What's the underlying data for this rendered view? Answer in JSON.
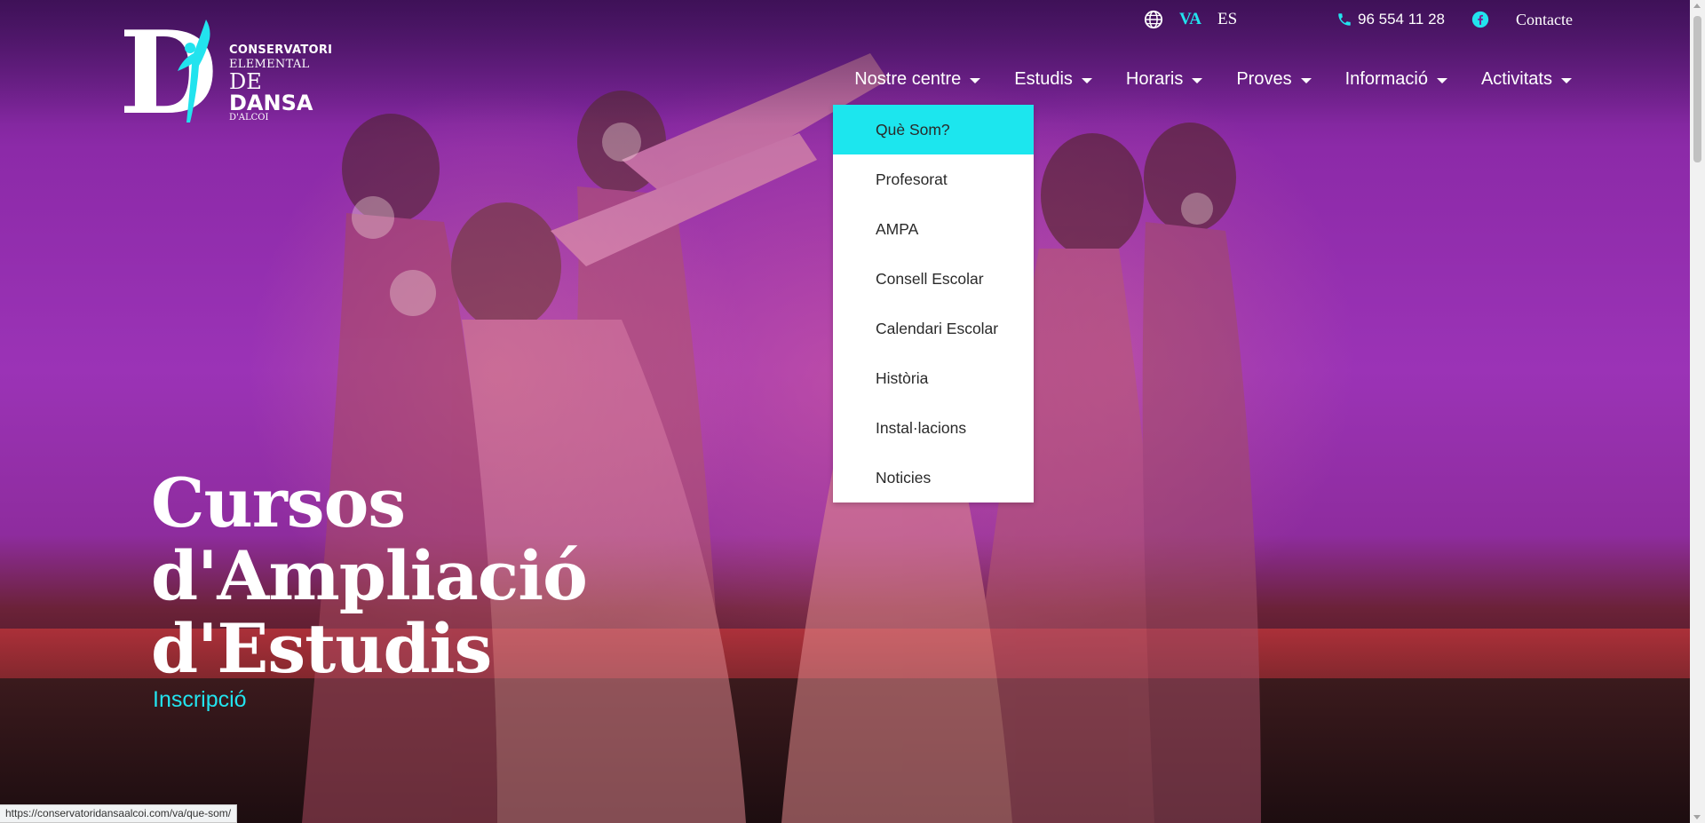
{
  "logo": {
    "letter": "D",
    "line1": "CONSERVATORI",
    "line2": "ELEMENTAL",
    "line3a": "DE",
    "line3b": "DANSA",
    "line4": "D'ALCOI"
  },
  "utility": {
    "languages": [
      {
        "code": "VA",
        "active": true
      },
      {
        "code": "ES",
        "active": false
      }
    ],
    "phone": "96 554 11 28",
    "contact": "Contacte"
  },
  "nav": {
    "items": [
      {
        "label": "Nostre centre"
      },
      {
        "label": "Estudis"
      },
      {
        "label": "Horaris"
      },
      {
        "label": "Proves"
      },
      {
        "label": "Informació"
      },
      {
        "label": "Activitats"
      }
    ]
  },
  "dropdown": {
    "items": [
      {
        "label": "Què Som?"
      },
      {
        "label": "Profesorat"
      },
      {
        "label": "AMPA"
      },
      {
        "label": "Consell Escolar"
      },
      {
        "label": "Calendari Escolar"
      },
      {
        "label": "Història"
      },
      {
        "label": "Instal·lacions"
      },
      {
        "label": "Noticies"
      }
    ]
  },
  "hero": {
    "title_lines": [
      "Cursos",
      "d'Ampliació",
      "d'Estudis"
    ],
    "link": "Inscripció"
  },
  "status": {
    "url": "https://conservatoridansaalcoi.com/va/que-som/"
  },
  "colors": {
    "accent": "#1ce6ee",
    "hero_purple": "#9b33b6",
    "text_white": "#ffffff"
  },
  "icons": [
    "globe-icon",
    "phone-icon",
    "facebook-icon",
    "caret-down-icon",
    "dancer-logo-icon"
  ]
}
